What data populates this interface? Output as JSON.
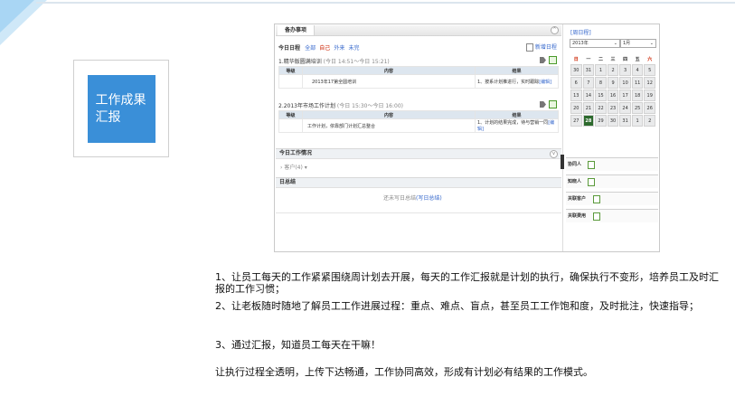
{
  "card": {
    "title": "工作成果汇报"
  },
  "panel": {
    "tab": "备办事项",
    "today_schedule": {
      "title": "今日日程",
      "filters": [
        "全部",
        "自己",
        "外来",
        "未完"
      ],
      "new_button": "新增日程",
      "items": [
        {
          "heading": "1.精华版圆满培训",
          "time": "(今日 14:51～今日 15:21)",
          "columns": [
            "等级",
            "内容",
            "结果"
          ],
          "content": "2013年17第全圆培训",
          "result_text": "1、按系计划推进行，实时跟踪",
          "result_link": "[编辑]"
        },
        {
          "heading": "2.2013年市场工作计划",
          "time": "(今日 15:30～今日 16:00)",
          "columns": [
            "等级",
            "内容",
            "结果"
          ],
          "content": "工作计划，依靠部门计划汇总整合",
          "result_text": "1、计划的结果完成，待与营销一同",
          "result_link": "[编辑]"
        }
      ]
    },
    "today_work": {
      "title": "今日工作情况",
      "row": "客户(4)"
    },
    "daily_summary": {
      "title": "日总结",
      "empty_text": "还未写日总结",
      "write_link": "(写日总结)"
    }
  },
  "calendar": {
    "link": "[周日程]",
    "year": "2013年",
    "month": "1月",
    "weekdays": [
      "日",
      "一",
      "二",
      "三",
      "四",
      "五",
      "六"
    ],
    "weeks": [
      [
        "30",
        "31",
        "1",
        "2",
        "3",
        "4",
        "5"
      ],
      [
        "6",
        "7",
        "8",
        "9",
        "10",
        "11",
        "12"
      ],
      [
        "13",
        "14",
        "15",
        "16",
        "17",
        "18",
        "19"
      ],
      [
        "20",
        "21",
        "22",
        "23",
        "24",
        "25",
        "26"
      ],
      [
        "27",
        "28",
        "29",
        "30",
        "31",
        "1",
        "2"
      ]
    ],
    "today": "28",
    "side_items": [
      "协同人",
      "知晓人",
      "关联客户",
      "关联费用"
    ]
  },
  "text": {
    "p1": "1、让员工每天的工作紧紧围绕周计划去开展，每天的工作汇报就是计划的执行，确保执行不变形，培养员工及时汇报的工作习惯；",
    "p2": "2、让老板随时随地了解员工工作进展过程：重点、难点、盲点，甚至员工工作饱和度，及时批注，快速指导；",
    "p3": "3、通过汇报，知道员工每天在干嘛！",
    "p4": "让执行过程全透明，上传下达畅通，工作协同高效，形成有计划必有结果的工作模式。"
  }
}
